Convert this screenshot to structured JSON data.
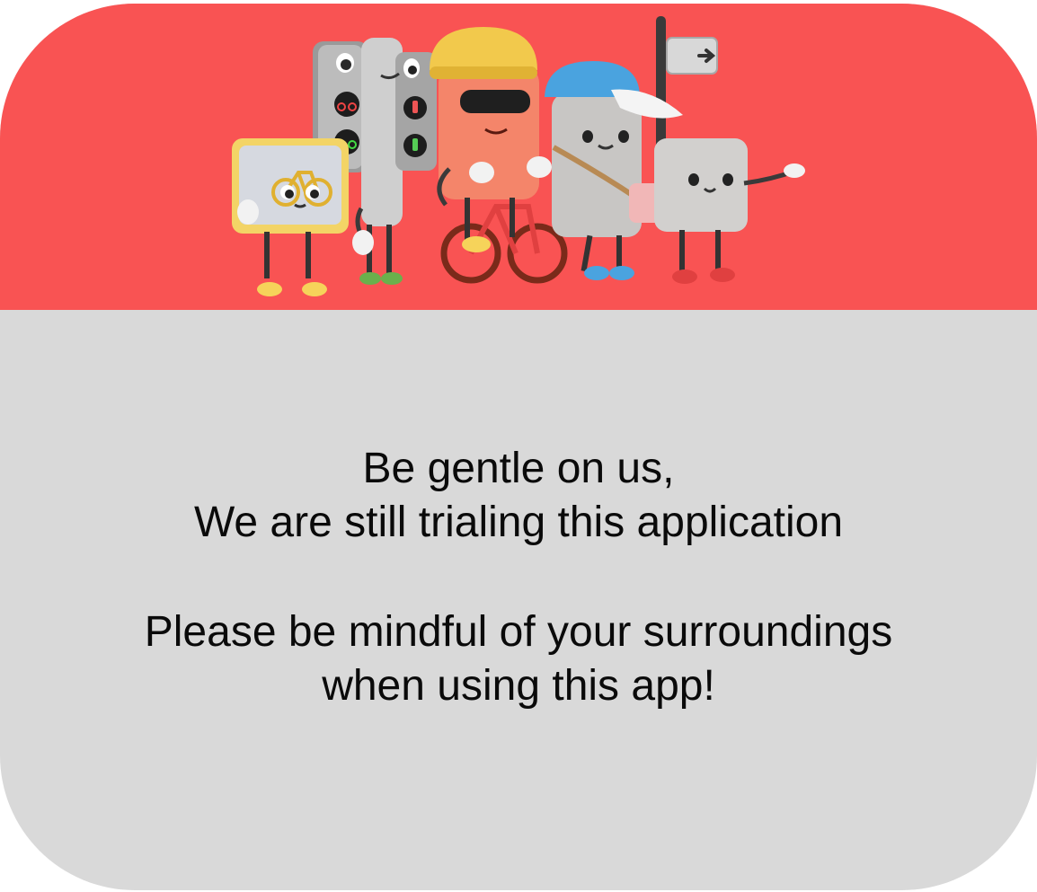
{
  "colors": {
    "hero_background": "#f95353",
    "card_background": "#d9d9d9",
    "text": "#0a0a0a"
  },
  "hero": {
    "illustration": "cartoon-traffic-characters",
    "characters": [
      "bike-sign-character",
      "cycle-traffic-light-character",
      "pedestrian-traffic-light-character",
      "cyclist-character",
      "pedestrian-character-with-cap",
      "signpost-character"
    ]
  },
  "message": {
    "line1": "Be gentle on us,",
    "line2": "We are still trialing this application",
    "line3": "Please be mindful of your surroundings",
    "line4": "when using this app!"
  }
}
